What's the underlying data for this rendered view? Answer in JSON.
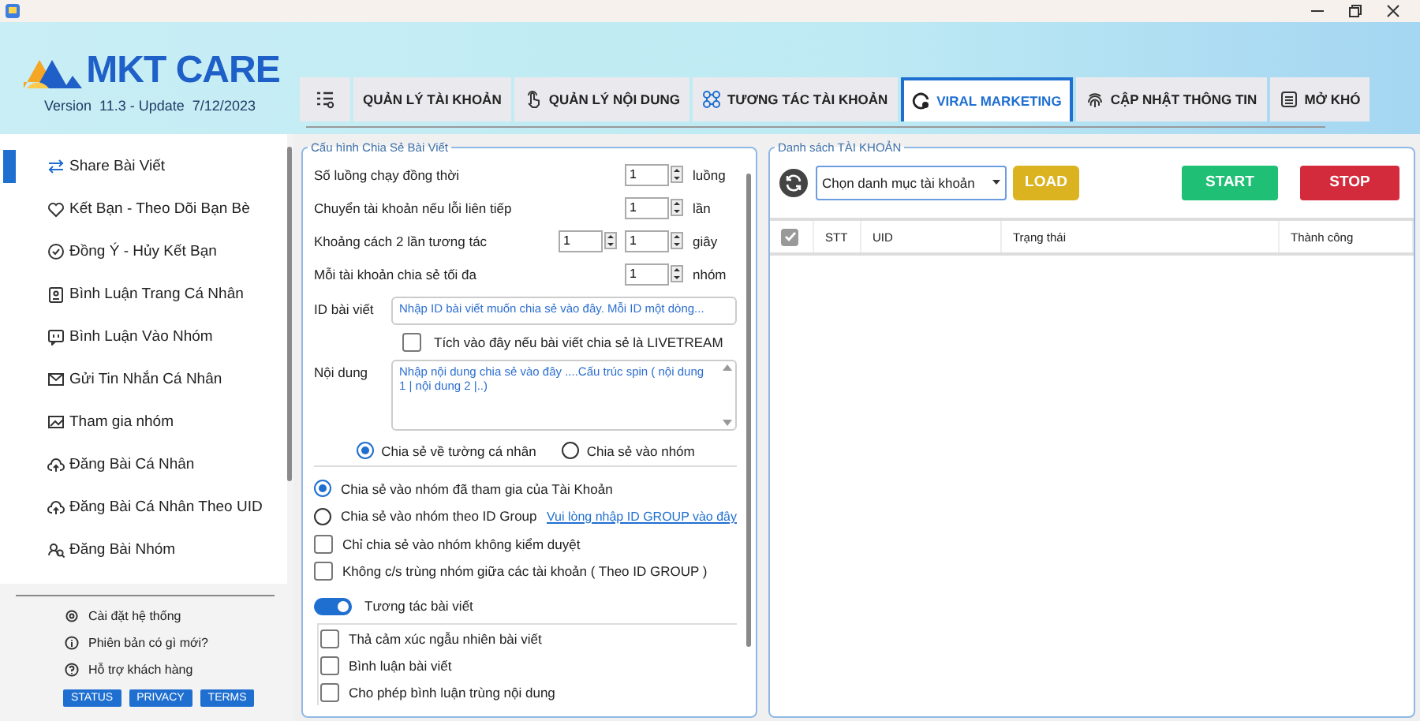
{
  "header": {
    "logo": "MKT CARE",
    "version": "Version  11.3 - Update  7/12/2023"
  },
  "tabs": [
    {
      "label": "QUẢN LÝ TÀI KHOẢN",
      "selected": false
    },
    {
      "label": "QUẢN LÝ NỘI DUNG",
      "selected": false
    },
    {
      "label": "TƯƠNG TÁC TÀI KHOẢN",
      "selected": false
    },
    {
      "label": "VIRAL MARKETING",
      "selected": true
    },
    {
      "label": "CẬP NHẬT THÔNG TIN",
      "selected": false
    },
    {
      "label": "MỞ KHÓ",
      "selected": false
    }
  ],
  "sidebar": {
    "items": [
      {
        "label": "Share Bài Viết",
        "selected": true
      },
      {
        "label": "Kết Bạn - Theo Dõi Bạn Bè",
        "selected": false
      },
      {
        "label": "Đồng Ý - Hủy Kết Bạn",
        "selected": false
      },
      {
        "label": "Bình Luận Trang Cá Nhân",
        "selected": false
      },
      {
        "label": "Bình Luận Vào Nhóm",
        "selected": false
      },
      {
        "label": "Gửi Tin Nhắn Cá Nhân",
        "selected": false
      },
      {
        "label": "Tham gia nhóm",
        "selected": false
      },
      {
        "label": "Đăng Bài Cá Nhân",
        "selected": false
      },
      {
        "label": "Đăng Bài Cá Nhân Theo UID",
        "selected": false
      },
      {
        "label": "Đăng Bài Nhóm",
        "selected": false
      }
    ],
    "footer_links": [
      "Cài đặt hệ thống",
      "Phiên bản có gì mới?",
      "Hỗ trợ khách hàng"
    ],
    "badges": [
      "STATUS",
      "PRIVACY",
      "TERMS"
    ]
  },
  "config": {
    "title": "Cấu hình Chia Sẻ Bài Viết",
    "number_rows": [
      {
        "label": "Số luồng chạy đồng thời",
        "values": [
          "1"
        ],
        "unit": "luồng"
      },
      {
        "label": "Chuyển tài khoản nếu lỗi liên tiếp",
        "values": [
          "1"
        ],
        "unit": "lần"
      },
      {
        "label": "Khoảng cách 2 lần tương tác",
        "values": [
          "1",
          "1"
        ],
        "unit": "giây"
      },
      {
        "label": "Mỗi tài khoản chia sẻ tối đa",
        "values": [
          "1"
        ],
        "unit": "nhóm"
      }
    ],
    "post_id": {
      "label": "ID bài viết",
      "placeholder": "Nhập ID bài viết muốn chia sẻ vào đây. Mỗi ID một dòng..."
    },
    "livestream": {
      "label": "Tích vào đây nếu bài viết chia sẻ là LIVETREAM",
      "checked": false
    },
    "content": {
      "label": "Nội dung",
      "placeholder": "Nhập nội dung chia sẻ vào đây ....Cấu trúc spin ( nội dung 1 | nội dung 2 |..)"
    },
    "share_targets": [
      {
        "label": "Chia sẻ về tường cá nhân",
        "selected": true
      },
      {
        "label": "Chia sẻ vào nhóm",
        "selected": false
      }
    ],
    "group_options": [
      {
        "kind": "radio",
        "label": "Chia sẻ vào nhóm đã tham gia của Tài Khoản",
        "selected": true
      },
      {
        "kind": "radio",
        "label": "Chia sẻ vào nhóm theo ID Group",
        "selected": false,
        "link": "Vui lòng nhập ID GROUP vào đây"
      },
      {
        "kind": "checkbox",
        "label": "Chỉ chia sẻ vào nhóm không kiểm duyệt",
        "checked": false
      },
      {
        "kind": "checkbox",
        "label": "Không c/s trùng nhóm giữa các tài khoản ( Theo ID GROUP )",
        "checked": false
      }
    ],
    "interact": {
      "label": "Tương tác bài viết",
      "on": true
    },
    "interact_options": [
      {
        "label": "Thả cảm xúc ngẫu nhiên bài viết",
        "checked": false
      },
      {
        "label": "Bình luận bài viết",
        "checked": false
      },
      {
        "label": "Cho phép bình luận trùng nội dung",
        "checked": false
      }
    ]
  },
  "accounts": {
    "title": "Danh sách TÀI KHOẢN",
    "category": "Chọn danh mục tài khoản",
    "buttons": [
      {
        "kind": "load",
        "label": "LOAD"
      },
      {
        "kind": "start",
        "label": "START"
      },
      {
        "kind": "stop",
        "label": "STOP"
      }
    ],
    "select_all": true,
    "columns": [
      "STT",
      "UID",
      "Trạng thái",
      "Thành công"
    ]
  }
}
